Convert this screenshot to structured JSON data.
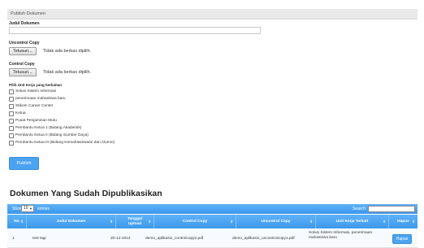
{
  "panel": {
    "title": "Publish Dokumen"
  },
  "form": {
    "judul_label": "Judul Dokumen",
    "judul_value": "",
    "uncontrol_label": "Uncontrol Copy",
    "uncontrol_button": "Telusuri...",
    "uncontrol_status": "Tidak ada berkas dipilih.",
    "control_label": "Control Copy",
    "control_button": "Telusuri...",
    "control_status": "Tidak ada berkas dipilih.",
    "unit_label": "Pilih Unit Kerja yang berkaitan",
    "units": [
      {
        "label": "Solusi Sistem Informasi",
        "checked": false
      },
      {
        "label": "penerimaan mahasiswa baru",
        "checked": false
      },
      {
        "label": "Stikom Career Center",
        "checked": false
      },
      {
        "label": "Ketua",
        "checked": false
      },
      {
        "label": "Pusat Penjaminan Mutu",
        "checked": false
      },
      {
        "label": "Pembantu Ketua 1 (Bidang Akademik)",
        "checked": false
      },
      {
        "label": "Pembantu Ketua II (Bidang Sumber Daya)",
        "checked": false
      },
      {
        "label": "Pembantu Ketua III (Bidang Kemahasiswaan dan Alumni)",
        "checked": false
      }
    ],
    "publish_button": "Publish"
  },
  "published": {
    "heading": "Dokumen Yang Sudah Dipublikasikan",
    "show_label": "Show",
    "entries_value": "10",
    "entries_label": "entries",
    "search_label": "Search:",
    "columns": [
      "No",
      "Judul Dokumen",
      "Tanggal Upload",
      "Control Copy",
      "Uncontrol Copy",
      "Unit Kerja Terkait",
      "Hapus"
    ],
    "rows": [
      {
        "no": "1",
        "judul": "test lagi",
        "tanggal": "20-12-2014",
        "control": "demo_aplikasi1_controlcopy2.pdf",
        "uncontrol": "demo_aplikasi1_uncontrolcopy1.pdf",
        "unit": "Solusi Sistem Informasi, penerimaan mahasiswa baru",
        "hapus": "Hapus"
      }
    ]
  },
  "colors": {
    "accent": "#4aa3f0",
    "header": "#e9e9e9"
  },
  "icons": {
    "sort": "sort-arrows-icon",
    "dropdown": "chevron-down-icon"
  }
}
